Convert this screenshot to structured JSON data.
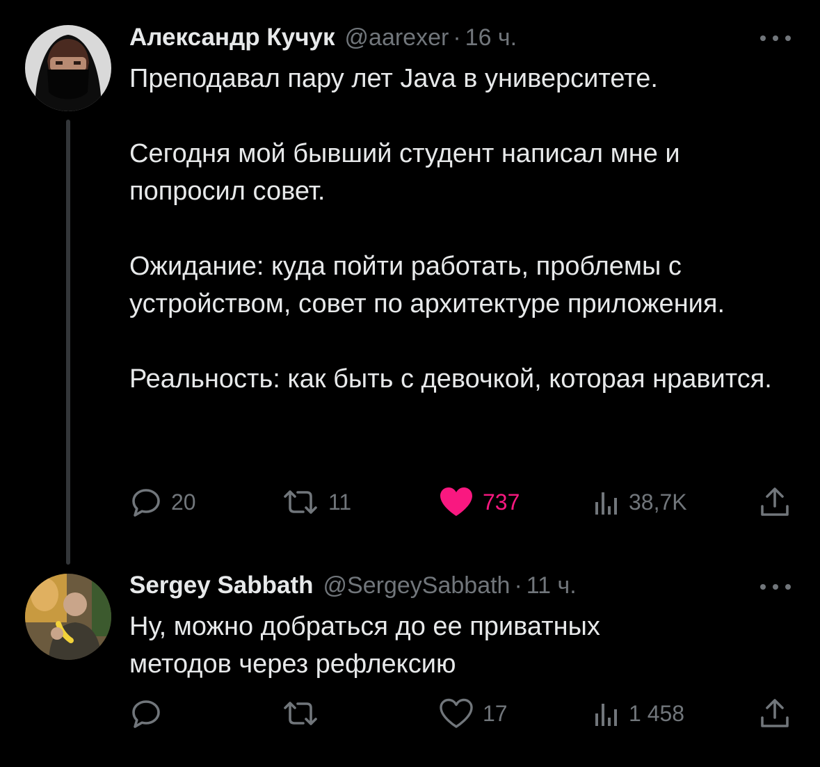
{
  "tweets": [
    {
      "author": {
        "display_name": "Александр Кучук",
        "handle": "@aarexer",
        "avatar_icon": "avatar-hooded-person"
      },
      "separator": "·",
      "time": "16 ч.",
      "paragraphs": [
        "Преподавал пару лет Java в университете.",
        "Сегодня мой бывший студент написал мне и попросил совет.",
        "Ожидание: куда пойти работать, проблемы с устройством, совет по архитектуре приложения.",
        "Реальность: как быть с девочкой, которая нравится."
      ],
      "actions": {
        "replies": "20",
        "reposts": "11",
        "likes": "737",
        "views": "38,7K",
        "liked": true
      }
    },
    {
      "author": {
        "display_name": "Sergey Sabbath",
        "handle": "@SergeySabbath",
        "avatar_icon": "avatar-man-with-banana"
      },
      "separator": "·",
      "time": "11 ч.",
      "paragraphs": [
        "Ну, можно добраться до ее приватных методов через рефлексию"
      ],
      "actions": {
        "replies": "",
        "reposts": "",
        "likes": "17",
        "views": "1 458",
        "liked": false
      }
    }
  ],
  "colors": {
    "background": "#000000",
    "text_primary": "#e7e9ea",
    "text_secondary": "#71767b",
    "like_active": "#f91880",
    "thread_line": "#333639"
  }
}
